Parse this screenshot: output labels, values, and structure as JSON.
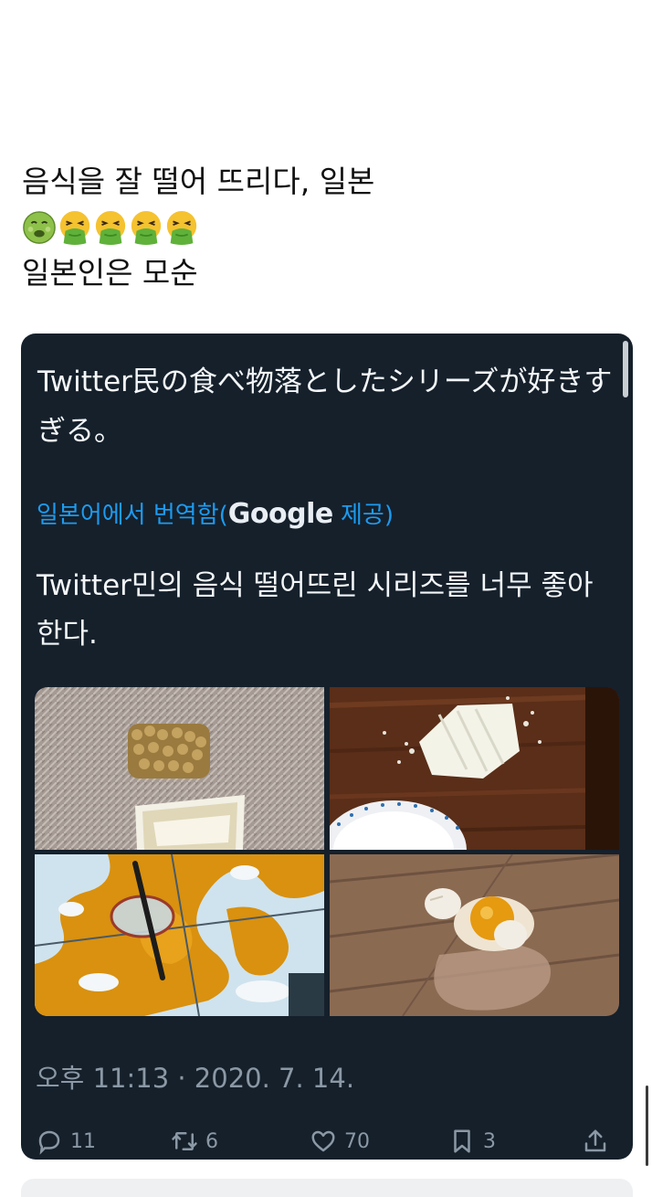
{
  "post": {
    "line1": "음식을 잘 떨어 뜨리다, 일본",
    "emojis": [
      "nauseated-face-icon",
      "vomiting-face-icon",
      "vomiting-face-icon",
      "vomiting-face-icon",
      "vomiting-face-icon"
    ],
    "line3": "일본인은 모순"
  },
  "tweet": {
    "original_text": "Twitter民の食べ物落としたシリーズが好きすぎる。",
    "translated_by_prefix": "일본어에서 번역함(",
    "translated_by_brand": "Google",
    "translated_by_suffix": " 제공)",
    "translated_text": "Twitter민의 음식 떨어뜨린 시리즈를 너무 좋아한다.",
    "timestamp": "오후 11:13 · 2020. 7. 14.",
    "photos": [
      {
        "name": "natto-on-carpet"
      },
      {
        "name": "tofu-on-wood-table"
      },
      {
        "name": "spilled-drink-on-floor"
      },
      {
        "name": "egg-on-floor"
      }
    ],
    "actions": {
      "reply_count": "11",
      "retweet_count": "6",
      "like_count": "70",
      "bookmark_count": "3"
    }
  }
}
